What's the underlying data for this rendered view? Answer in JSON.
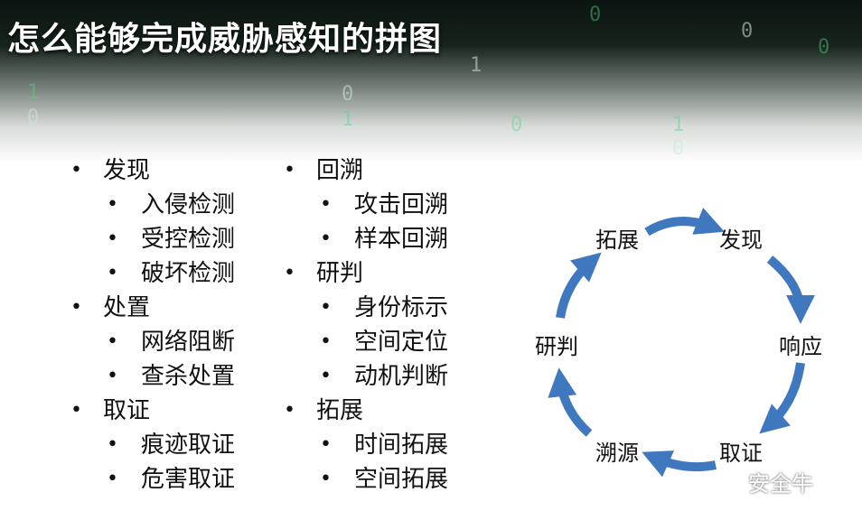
{
  "title": "怎么能够完成威胁感知的拼图",
  "background_digits": [
    "0",
    "0",
    "0",
    "1",
    "0",
    "0",
    "1",
    "1",
    "0",
    "0",
    "1"
  ],
  "bullet_char": "•",
  "left_column": [
    {
      "label": "发现",
      "children": [
        "入侵检测",
        "受控检测",
        "破坏检测"
      ]
    },
    {
      "label": "处置",
      "children": [
        "网络阻断",
        "查杀处置"
      ]
    },
    {
      "label": "取证",
      "children": [
        "痕迹取证",
        "危害取证"
      ]
    }
  ],
  "middle_column": [
    {
      "label": "回溯",
      "children": [
        "攻击回溯",
        "样本回溯"
      ]
    },
    {
      "label": "研判",
      "children": [
        "身份标示",
        "空间定位",
        "动机判断"
      ]
    },
    {
      "label": "拓展",
      "children": [
        "时间拓展",
        "空间拓展"
      ]
    }
  ],
  "cycle": {
    "nodes": [
      "发现",
      "响应",
      "取证",
      "溯源",
      "研判",
      "拓展"
    ],
    "arrow_color": "#3f78bf"
  },
  "watermark": {
    "text": "安全牛",
    "icon": "wechat-icon"
  }
}
